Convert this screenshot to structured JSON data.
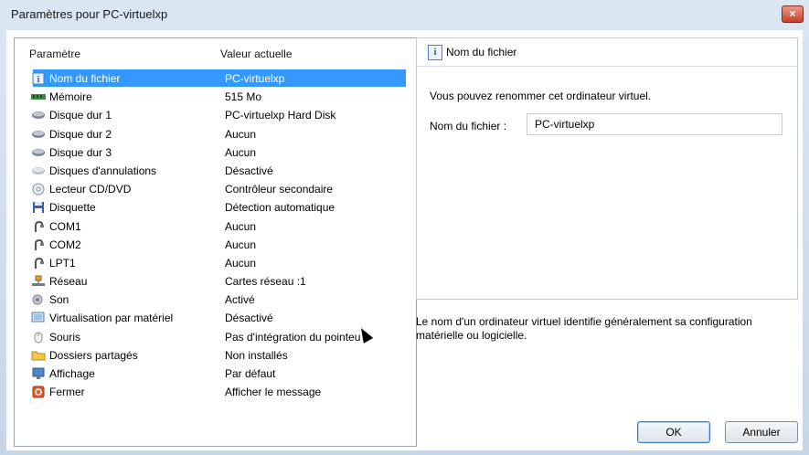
{
  "window": {
    "title": "Paramètres pour PC-virtuelxp",
    "close_icon": "×"
  },
  "settings_table": {
    "headers": {
      "param": "Paramètre",
      "value": "Valeur actuelle"
    },
    "rows": [
      {
        "icon": "info-icon",
        "name": "Nom du fichier",
        "value": "PC-virtuelxp",
        "selected": true
      },
      {
        "icon": "memory-icon",
        "name": "Mémoire",
        "value": "515 Mo"
      },
      {
        "icon": "hard-disk-icon",
        "name": "Disque dur 1",
        "value": "PC-virtuelxp Hard Disk"
      },
      {
        "icon": "hard-disk-icon",
        "name": "Disque dur 2",
        "value": "Aucun"
      },
      {
        "icon": "hard-disk-icon",
        "name": "Disque dur 3",
        "value": "Aucun"
      },
      {
        "icon": "undo-disk-icon",
        "name": "Disques d'annulations",
        "value": "Désactivé"
      },
      {
        "icon": "cd-dvd-icon",
        "name": "Lecteur CD/DVD",
        "value": "Contrôleur secondaire"
      },
      {
        "icon": "floppy-icon",
        "name": "Disquette",
        "value": "Détection automatique"
      },
      {
        "icon": "port-icon",
        "name": "COM1",
        "value": "Aucun"
      },
      {
        "icon": "port-icon",
        "name": "COM2",
        "value": "Aucun"
      },
      {
        "icon": "port-icon",
        "name": "LPT1",
        "value": "Aucun"
      },
      {
        "icon": "network-icon",
        "name": "Réseau",
        "value": "Cartes réseau :1"
      },
      {
        "icon": "sound-icon",
        "name": "Son",
        "value": "Activé"
      },
      {
        "icon": "hardware-virtualization-icon",
        "name": "Virtualisation par matériel",
        "value": "Désactivé"
      },
      {
        "icon": "mouse-icon",
        "name": "Souris",
        "value": "Pas d'intégration du pointeu"
      },
      {
        "icon": "shared-folder-icon",
        "name": "Dossiers partagés",
        "value": "Non installés"
      },
      {
        "icon": "display-icon",
        "name": "Affichage",
        "value": "Par défaut"
      },
      {
        "icon": "close-vm-icon",
        "name": "Fermer",
        "value": "Afficher le message"
      }
    ]
  },
  "detail": {
    "icon_glyph": "i",
    "title": "Nom du fichier",
    "description": "Vous pouvez renommer cet ordinateur virtuel.",
    "field_label": "Nom du fichier :",
    "field_value": "PC-virtuelxp",
    "help": "Le nom d'un ordinateur virtuel identifie généralement sa configuration matérielle ou logicielle."
  },
  "buttons": {
    "ok": "OK",
    "cancel": "Annuler"
  },
  "colors": {
    "selection": "#3399ff",
    "title_bg": "#c7d6e8"
  }
}
